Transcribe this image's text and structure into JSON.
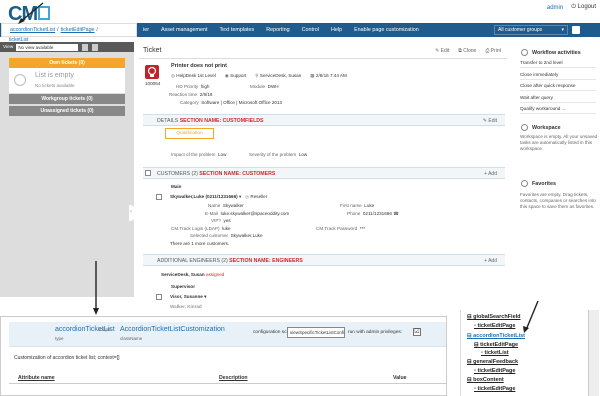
{
  "brand": {
    "logo": "CM"
  },
  "top_right": {
    "user": "admin",
    "logout": "Logout"
  },
  "breadcrumb": [
    "accordionTicketList",
    "/",
    "ticketEditPage",
    "/",
    "ticketList"
  ],
  "nav": {
    "items": [
      "ier",
      "Asset management",
      "Text templates",
      "Reporting",
      "Control",
      "Help",
      "Enable page customization"
    ],
    "customer_groups": "All customer groups"
  },
  "left": {
    "view_label": "View",
    "view_select": "No view available",
    "own_tickets": "Own tickets (0)",
    "list_empty": "List is empty",
    "no_tickets": "No tickets available",
    "workgroup_tickets": "Workgroup tickets (0)",
    "unassigned_tickets": "Unassigned tickets (0)"
  },
  "ticket": {
    "header": "Ticket",
    "actions": [
      "Edit",
      "Clone",
      "Print"
    ],
    "id": "100064",
    "subject": "Printer does not print",
    "meta_line": [
      "HelpDesk 1st Level",
      "Support",
      "ServiceDesk, Susan",
      "2/8/16 7:44 AM"
    ],
    "fields": [
      {
        "k": "HD Priority",
        "v": "high"
      },
      {
        "k": "Module",
        "v": "DWH"
      },
      {
        "k": "Reaction time",
        "v": "2/9/16"
      },
      {
        "k": "Category",
        "v": "Software | Office | Microsoft Office 2013"
      }
    ]
  },
  "details": {
    "title": "DETAILS",
    "section_name": "SECTION NAME: CUSTOMFIELDS",
    "edit": "Edit",
    "qualification": "Qualification",
    "impact_label": "Impact of the problem",
    "impact_value": "Low",
    "severity_label": "Severity of the problem",
    "severity_value": "Low"
  },
  "customers": {
    "title": "CUSTOMERS (2)",
    "section_name": "SECTION NAME: CUSTOMERS",
    "add": "+ Add",
    "main": "Main",
    "name_line": "Skywalker,Luke (0211/1231666)",
    "reseller": "Reseller",
    "rows": [
      {
        "k": "Name",
        "v": "Skywalker"
      },
      {
        "k": "E-Mail",
        "v": "luke.skywalker@spaceoddity.com"
      },
      {
        "k": "VIP?",
        "v": "yes"
      },
      {
        "k": "CM.Track Login (LDAP)",
        "v": "luke"
      },
      {
        "k": "Selected customer",
        "v": "Skywalker,Luke"
      }
    ],
    "rows_right": [
      {
        "k": "First name",
        "v": "Luke"
      },
      {
        "k": "Phone",
        "v": "0211/1231666"
      },
      {
        "k": "CM.Track Password",
        "v": "***"
      }
    ],
    "more": "There are 1 more customers."
  },
  "engineers": {
    "title": "ADDITIONAL ENGINEERS (2)",
    "section_name": "SECTION NAME: ENGINEERS",
    "add": "+ Add",
    "first": "ServiceDesk, Susan",
    "first_status": "assigned",
    "supervisor": "Supervisor",
    "second": "Visor, Susanne",
    "third": "Walker, Kinrad"
  },
  "right_panel": {
    "workflow_title": "Workflow activities",
    "workflow_items": [
      "Transfer to 2nd level",
      "Close immediately",
      "Close after quick response",
      "Wait after query",
      "Qualify workaround ..."
    ],
    "workspace_title": "Workspace",
    "workspace_text": "Workspace is empty. All your unsaved tasks are automatically listed in this workspace.",
    "favorites_title": "Favorites",
    "favorites_text": "Favorites are empty. Drag tickets, contacts, companies or searches into this space to save them as favorites."
  },
  "customization": {
    "component_name": "accordionTicketList",
    "type_label": "type",
    "scope_label": "scope",
    "class_name": "AccordionTicketListCustomization",
    "class_label": "className",
    "config_label": "configuration script:",
    "config_value": "viewSpecificTicketListConfiguration",
    "run_label": "run with admin privileges:",
    "run_checked": "☑",
    "description": "Customization of accordion ticket list; context=[]",
    "col_attr": "Attribute name",
    "col_desc": "Description",
    "col_value": "Value"
  },
  "tree": {
    "nodes": [
      {
        "label": "globalSearchField",
        "indent": 0
      },
      {
        "label": "ticketEditPage",
        "indent": 1
      },
      {
        "label": "accordionTicketList",
        "indent": 0,
        "selected": true
      },
      {
        "label": "ticketEditPage",
        "indent": 1
      },
      {
        "label": "ticketList",
        "indent": 2
      },
      {
        "label": "generalFeedback",
        "indent": 0
      },
      {
        "label": "ticketEditPage",
        "indent": 1
      },
      {
        "label": "boxContent",
        "indent": 0
      },
      {
        "label": "ticketEditPage",
        "indent": 1
      }
    ]
  },
  "colors": {
    "nav": "#1f5b8c",
    "accent_orange": "#f4a52a",
    "link_blue": "#1a6fb5",
    "section_red": "#d0272d"
  }
}
